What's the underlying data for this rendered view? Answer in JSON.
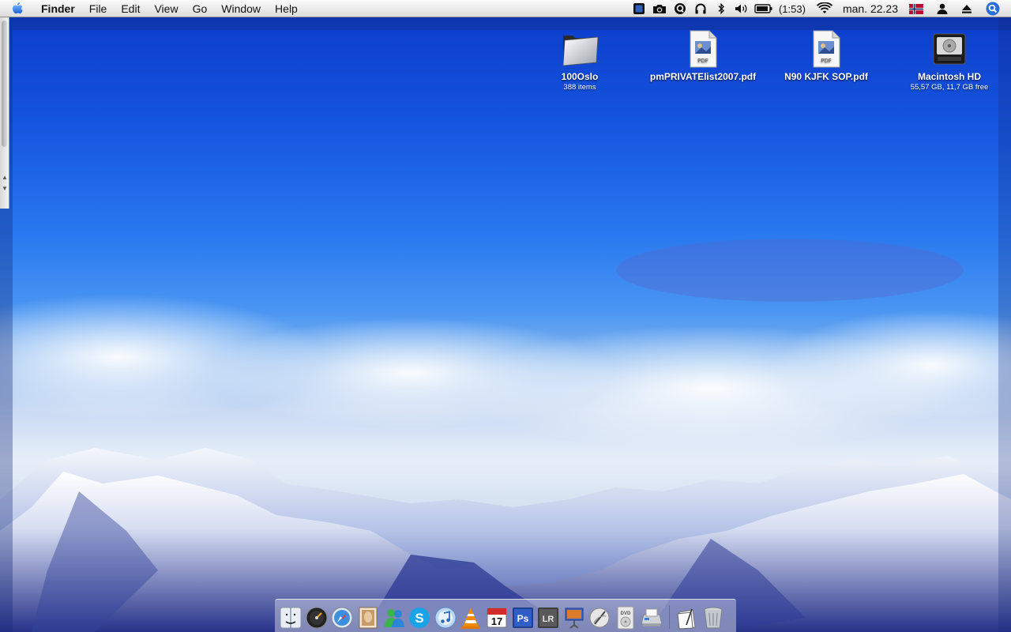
{
  "menubar": {
    "apple_icon": "apple-icon",
    "app_name": "Finder",
    "menus": [
      "File",
      "Edit",
      "View",
      "Go",
      "Window",
      "Help"
    ],
    "status": {
      "battery_time": "(1:53)",
      "clock": "man. 22.23"
    }
  },
  "desktop": {
    "icons": [
      {
        "name": "100Oslo",
        "detail": "388 items",
        "icon": "folder-icon"
      },
      {
        "name": "pmPRIVATElist2007.pdf",
        "detail": "",
        "icon": "pdf-document-icon",
        "badge": "PDF"
      },
      {
        "name": "N90 KJFK SOP.pdf",
        "detail": "",
        "icon": "pdf-document-icon",
        "badge": "PDF"
      },
      {
        "name": "Macintosh HD",
        "detail": "55,57 GB, 11,7 GB free",
        "icon": "hard-drive-icon"
      }
    ]
  },
  "dock": {
    "apps": [
      {
        "name": "Finder",
        "icon": "finder-icon"
      },
      {
        "name": "Dashboard",
        "icon": "dashboard-icon"
      },
      {
        "name": "Safari",
        "icon": "safari-icon"
      },
      {
        "name": "Mail",
        "icon": "mail-icon"
      },
      {
        "name": "Messenger",
        "icon": "messenger-icon"
      },
      {
        "name": "Skype",
        "icon": "skype-icon",
        "glyph": "S"
      },
      {
        "name": "iTunes",
        "icon": "itunes-icon"
      },
      {
        "name": "VLC",
        "icon": "vlc-icon"
      },
      {
        "name": "iCal",
        "icon": "ical-icon",
        "glyph": "17"
      },
      {
        "name": "Photoshop",
        "icon": "photoshop-icon",
        "glyph": "Ps"
      },
      {
        "name": "Lightroom",
        "icon": "lightroom-icon",
        "glyph": "LR"
      },
      {
        "name": "Keynote",
        "icon": "keynote-icon"
      },
      {
        "name": "Script Editor",
        "icon": "script-editor-icon"
      },
      {
        "name": "DVD Player",
        "icon": "dvd-player-icon",
        "glyph": "DVD"
      },
      {
        "name": "Printer",
        "icon": "printer-icon"
      }
    ],
    "right": [
      {
        "name": "Documents",
        "icon": "documents-stack-icon"
      },
      {
        "name": "Trash",
        "icon": "trash-icon"
      }
    ]
  }
}
